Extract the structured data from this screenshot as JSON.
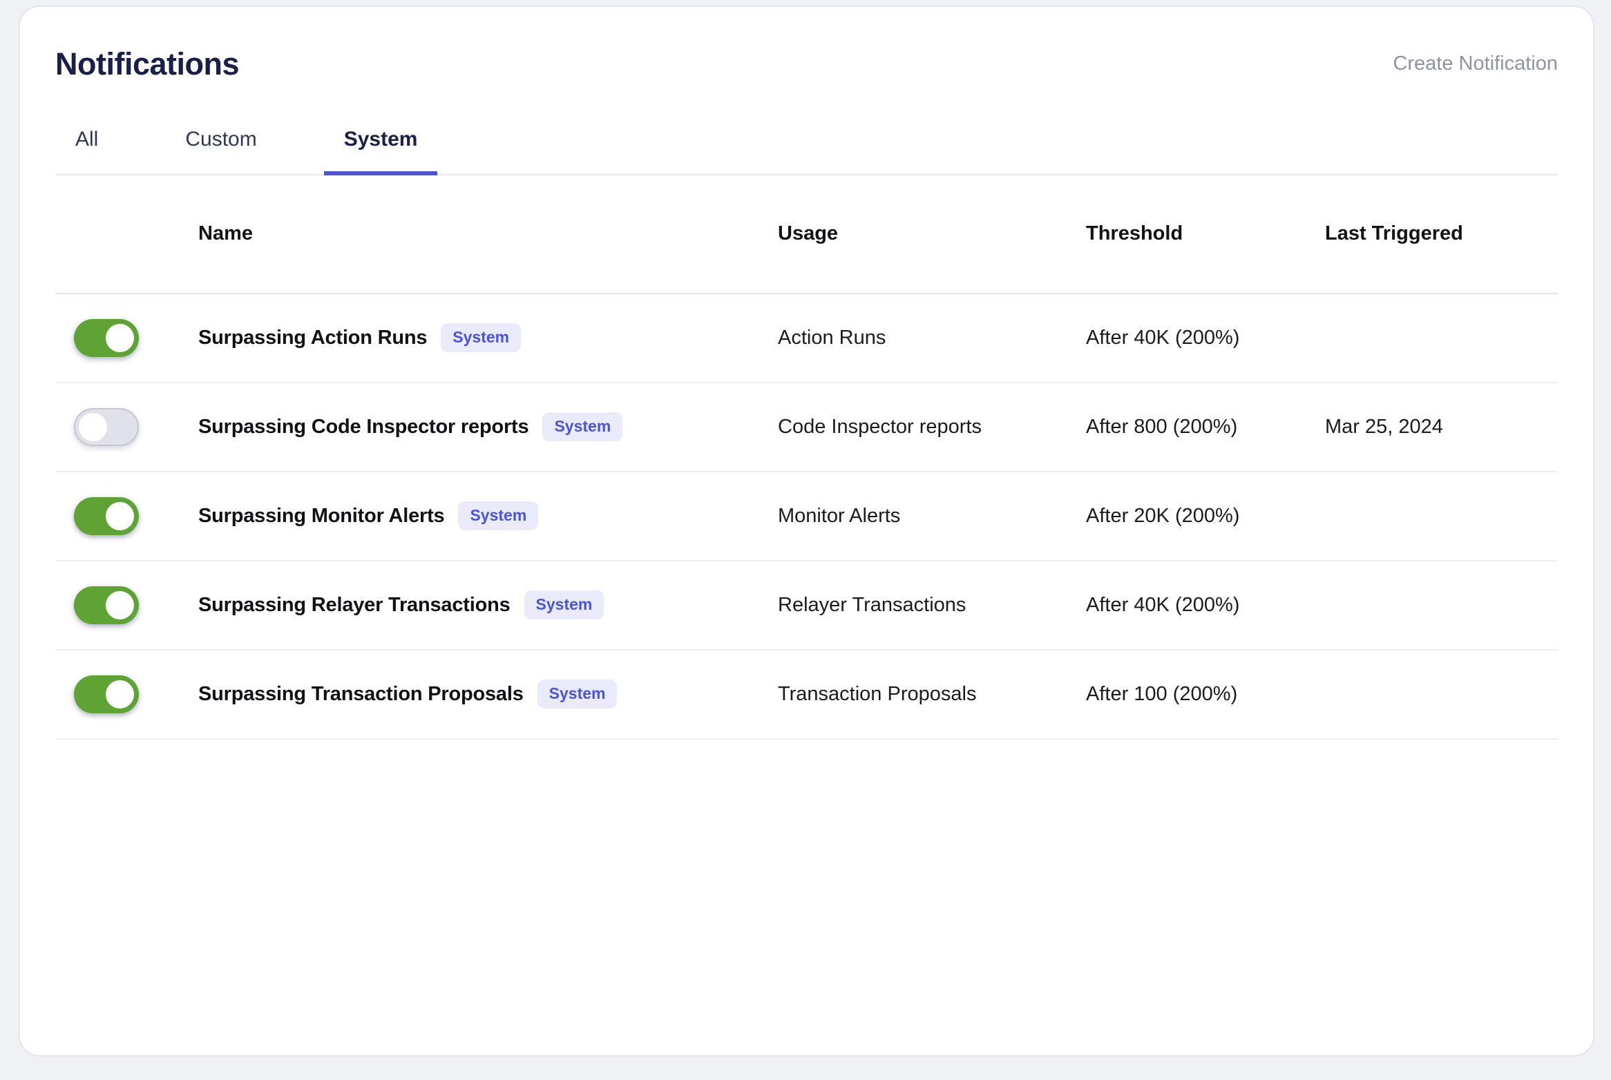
{
  "header": {
    "title": "Notifications",
    "create_button_label": "Create Notification"
  },
  "tabs": [
    {
      "label": "All",
      "active": false
    },
    {
      "label": "Custom",
      "active": false
    },
    {
      "label": "System",
      "active": true
    }
  ],
  "table": {
    "columns": [
      "Name",
      "Usage",
      "Threshold",
      "Last Triggered"
    ],
    "rows": [
      {
        "enabled": true,
        "name": "Surpassing Action Runs",
        "badge": "System",
        "usage": "Action Runs",
        "threshold": "After 40K (200%)",
        "last_triggered": ""
      },
      {
        "enabled": false,
        "name": "Surpassing Code Inspector reports",
        "badge": "System",
        "usage": "Code Inspector reports",
        "threshold": "After 800 (200%)",
        "last_triggered": "Mar 25, 2024"
      },
      {
        "enabled": true,
        "name": "Surpassing Monitor Alerts",
        "badge": "System",
        "usage": "Monitor Alerts",
        "threshold": "After 20K (200%)",
        "last_triggered": ""
      },
      {
        "enabled": true,
        "name": "Surpassing Relayer Transactions",
        "badge": "System",
        "usage": "Relayer Transactions",
        "threshold": "After 40K (200%)",
        "last_triggered": ""
      },
      {
        "enabled": true,
        "name": "Surpassing Transaction Proposals",
        "badge": "System",
        "usage": "Transaction Proposals",
        "threshold": "After 100 (200%)",
        "last_triggered": ""
      }
    ]
  },
  "colors": {
    "accent": "#4c52d9",
    "badge_bg": "#e9eafa",
    "toggle_on": "#5fa335",
    "toggle_off": "#e1e2e9",
    "title_color": "#191f47",
    "muted_color": "#8e92a8",
    "card_border": "#e4e5ef"
  }
}
